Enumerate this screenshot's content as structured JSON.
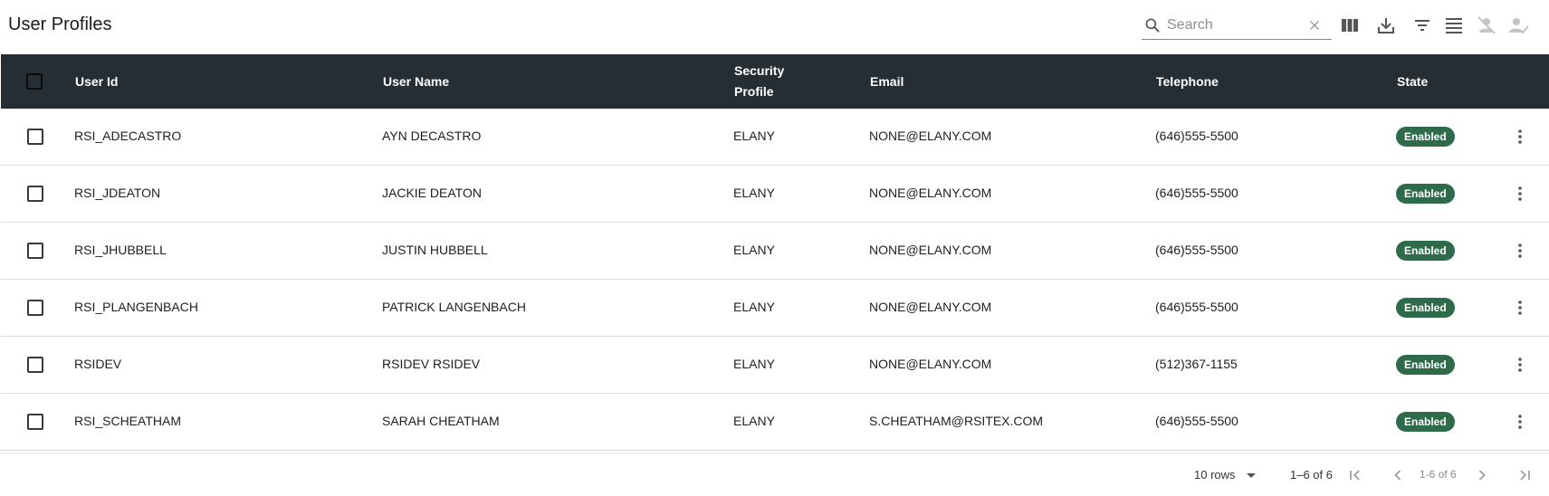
{
  "header": {
    "title": "User Profiles",
    "search": {
      "placeholder": "Search",
      "value": ""
    },
    "toolbar_icons": [
      "columns-icon",
      "download-icon",
      "filter-icon",
      "density-icon",
      "disable-user-icon",
      "enable-user-icon"
    ]
  },
  "table": {
    "columns": {
      "user_id": "User Id",
      "user_name": "User Name",
      "security_line1": "Security",
      "security_line2": "Profile",
      "email": "Email",
      "telephone": "Telephone",
      "state": "State"
    },
    "rows": [
      {
        "user_id": "RSI_ADECASTRO",
        "user_name": "AYN DECASTRO",
        "security": "ELANY",
        "email": "NONE@ELANY.COM",
        "telephone": "(646)555-5500",
        "state": "Enabled"
      },
      {
        "user_id": "RSI_JDEATON",
        "user_name": "JACKIE DEATON",
        "security": "ELANY",
        "email": "NONE@ELANY.COM",
        "telephone": "(646)555-5500",
        "state": "Enabled"
      },
      {
        "user_id": "RSI_JHUBBELL",
        "user_name": "JUSTIN HUBBELL",
        "security": "ELANY",
        "email": "NONE@ELANY.COM",
        "telephone": "(646)555-5500",
        "state": "Enabled"
      },
      {
        "user_id": "RSI_PLANGENBACH",
        "user_name": "PATRICK LANGENBACH",
        "security": "ELANY",
        "email": "NONE@ELANY.COM",
        "telephone": "(646)555-5500",
        "state": "Enabled"
      },
      {
        "user_id": "RSIDEV",
        "user_name": "RSIDEV RSIDEV",
        "security": "ELANY",
        "email": "NONE@ELANY.COM",
        "telephone": "(512)367-1155",
        "state": "Enabled"
      },
      {
        "user_id": "RSI_SCHEATHAM",
        "user_name": "SARAH CHEATHAM",
        "security": "ELANY",
        "email": "S.CHEATHAM@RSITEX.COM",
        "telephone": "(646)555-5500",
        "state": "Enabled"
      }
    ]
  },
  "footer": {
    "rows_per_page": "10 rows",
    "range": "1–6 of 6",
    "page_info": "1-6 of 6"
  },
  "colors": {
    "header_bg": "#252e35",
    "badge_bg": "#2e6b4b"
  }
}
